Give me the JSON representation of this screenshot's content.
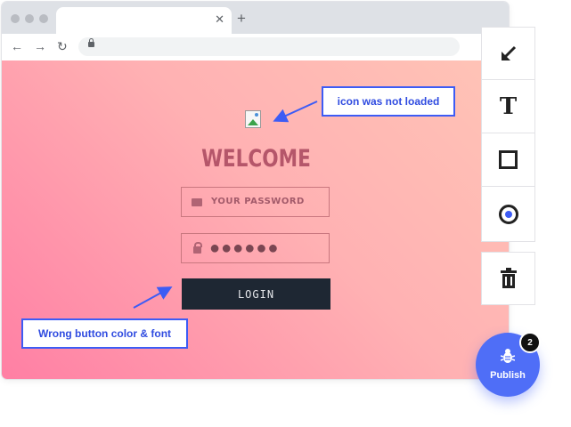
{
  "browser": {
    "tab": {
      "title": "",
      "close_icon": "close-icon"
    },
    "new_tab_icon": "plus-icon",
    "nav": {
      "back_icon": "arrow-left-icon",
      "forward_icon": "arrow-right-icon",
      "reload_icon": "reload-icon"
    },
    "address": {
      "url": "",
      "lock_icon": "lock-icon"
    }
  },
  "login_page": {
    "heading": "WELCOME",
    "email_field": {
      "placeholder": "YOUR PASSWORD",
      "icon": "mail-icon"
    },
    "password_field": {
      "value": "●●●●●●",
      "icon": "lock-icon"
    },
    "login_button": "LOGIN",
    "broken_image_icon": "broken-image-icon"
  },
  "annotations": {
    "icon_note": "icon was not loaded",
    "button_note": "Wrong button color & font",
    "accent_color": "#3d5cf5"
  },
  "tools": [
    {
      "name": "pointer-tool",
      "icon": "arrow-down-left-icon"
    },
    {
      "name": "text-tool",
      "icon": "text-icon",
      "glyph": "T"
    },
    {
      "name": "rectangle-tool",
      "icon": "square-icon"
    },
    {
      "name": "circle-tool",
      "icon": "circle-icon"
    },
    {
      "name": "delete-tool",
      "icon": "trash-icon"
    }
  ],
  "publish": {
    "label": "Publish",
    "badge_count": "2",
    "icon": "bug-icon"
  },
  "colors": {
    "page_gradient": [
      "#ff7fa4",
      "#ffb1b3",
      "#ffc4b6"
    ],
    "button_bg": "#1e2733",
    "publish_bg": "#4f6ef7"
  }
}
